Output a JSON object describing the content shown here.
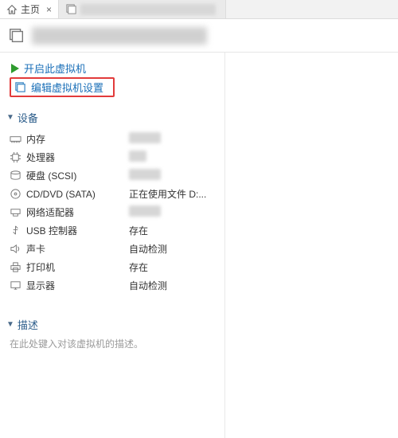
{
  "tabs": {
    "home_label": "主页",
    "second_label": "██████"
  },
  "titlebar": {
    "title": "██████"
  },
  "actions": {
    "power_on": "开启此虚拟机",
    "edit_settings": "编辑虚拟机设置"
  },
  "sections": {
    "devices_header": "设备",
    "description_header": "描述"
  },
  "devices": [
    {
      "icon": "memory-icon",
      "name": "内存",
      "value": ""
    },
    {
      "icon": "cpu-icon",
      "name": "处理器",
      "value": ""
    },
    {
      "icon": "hdd-icon",
      "name": "硬盘 (SCSI)",
      "value": ""
    },
    {
      "icon": "cd-icon",
      "name": "CD/DVD (SATA)",
      "value": "正在使用文件 D:..."
    },
    {
      "icon": "nic-icon",
      "name": "网络适配器",
      "value": ""
    },
    {
      "icon": "usb-icon",
      "name": "USB 控制器",
      "value": "存在"
    },
    {
      "icon": "sound-icon",
      "name": "声卡",
      "value": "自动检测"
    },
    {
      "icon": "printer-icon",
      "name": "打印机",
      "value": "存在"
    },
    {
      "icon": "display-icon",
      "name": "显示器",
      "value": "自动检测"
    }
  ],
  "description": {
    "placeholder": "在此处键入对该虚拟机的描述。"
  }
}
